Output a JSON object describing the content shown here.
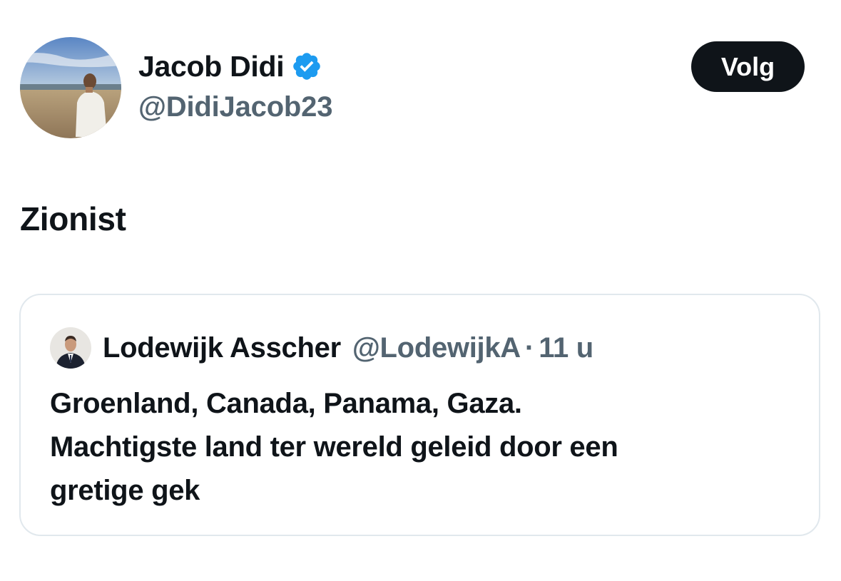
{
  "tweet": {
    "author": {
      "display_name": "Jacob Didi",
      "handle": "@DidiJacob23",
      "verified_icon": "verified-badge-icon",
      "avatar_icon": "profile-avatar"
    },
    "follow_label": "Volg",
    "text": "Zionist"
  },
  "quote": {
    "author": {
      "display_name": "Lodewijk Asscher",
      "handle": "@LodewijkA",
      "separator": "·",
      "time": "11 u",
      "avatar_icon": "profile-avatar"
    },
    "text_lines": [
      "Groenland, Canada, Panama, Gaza.",
      "Machtigste land ter wereld geleid door een",
      "gretige gek"
    ]
  },
  "colors": {
    "primary_text": "#0f1419",
    "secondary_text": "#536471",
    "verified_blue": "#1d9bf0",
    "card_border": "#e1e8ed",
    "button_bg": "#0f1419",
    "button_text": "#ffffff"
  }
}
